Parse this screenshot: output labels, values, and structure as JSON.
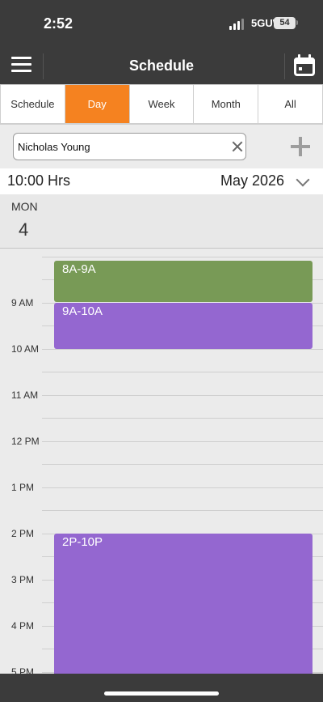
{
  "status": {
    "time": "2:52",
    "network": "5GUW",
    "battery": "54"
  },
  "header": {
    "title": "Schedule"
  },
  "tabs": [
    {
      "label": "Schedule",
      "active": false
    },
    {
      "label": "Day",
      "active": true
    },
    {
      "label": "Week",
      "active": false
    },
    {
      "label": "Month",
      "active": false
    },
    {
      "label": "All",
      "active": false
    }
  ],
  "filter": {
    "value": "Nicholas Young"
  },
  "datebar": {
    "hours_label": "10:00 Hrs",
    "month": "May 2026"
  },
  "day": {
    "weekday": "MON",
    "date": "4"
  },
  "hours": [
    "9 AM",
    "10 AM",
    "11 AM",
    "12 PM",
    "1 PM",
    "2 PM",
    "3 PM",
    "4 PM",
    "5 PM"
  ],
  "events": [
    {
      "label": "8A-9A",
      "color": "#789a56"
    },
    {
      "label": "9A-10A",
      "color": "#9467d0"
    },
    {
      "label": "2P-10P",
      "color": "#9467d0"
    }
  ],
  "colors": {
    "accent": "#f58220",
    "bar": "#3b3b3b"
  }
}
